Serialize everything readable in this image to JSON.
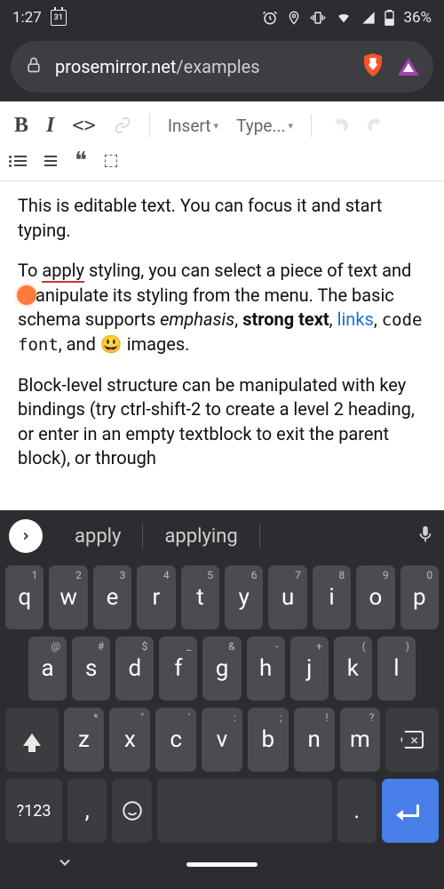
{
  "status": {
    "time": "1:27",
    "calendar_day": "31",
    "battery": "36%"
  },
  "browser": {
    "host": "prosemirror.net",
    "path": "/examples"
  },
  "toolbar": {
    "bold": "B",
    "italic": "I",
    "code": "<>",
    "insert_label": "Insert",
    "type_label": "Type..."
  },
  "content": {
    "p1": "This is editable text. You can focus it and start typing.",
    "p2_a": "To ",
    "p2_apply": "apply",
    "p2_b": " styling, you can select a piece of text and ",
    "p2_c": "anipulate its styling from the menu. The basic schema supports ",
    "p2_em": "emphasis",
    "p2_d": ", ",
    "p2_strong": "strong text",
    "p2_e": ", ",
    "p2_link": "links",
    "p2_f": ", ",
    "p2_code": "code font",
    "p2_g": ", and ",
    "p2_emoji": "😃",
    "p2_h": " images.",
    "p3": "Block-level structure can be manipulated with key bindings (try ctrl-shift-2 to create a level 2 heading, or enter in an empty textblock to exit the parent block), or through"
  },
  "suggestions": {
    "s1": "apply",
    "s2": "applying"
  },
  "keys": {
    "row1": [
      "q",
      "w",
      "e",
      "r",
      "t",
      "y",
      "u",
      "i",
      "o",
      "p"
    ],
    "row1alt": [
      "1",
      "2",
      "3",
      "4",
      "5",
      "6",
      "7",
      "8",
      "9",
      "0"
    ],
    "row2": [
      "a",
      "s",
      "d",
      "f",
      "g",
      "h",
      "j",
      "k",
      "l"
    ],
    "row2alt": [
      "",
      "@",
      "#",
      "$",
      "_",
      "&",
      "-",
      "+",
      "(",
      ")"
    ],
    "row3": [
      "z",
      "x",
      "c",
      "v",
      "b",
      "n",
      "m"
    ],
    "row3alt": [
      "",
      "*",
      "\"",
      "'",
      ":",
      ";",
      "!",
      "?"
    ],
    "symkey": "?123",
    "comma": ",",
    "period": "."
  }
}
